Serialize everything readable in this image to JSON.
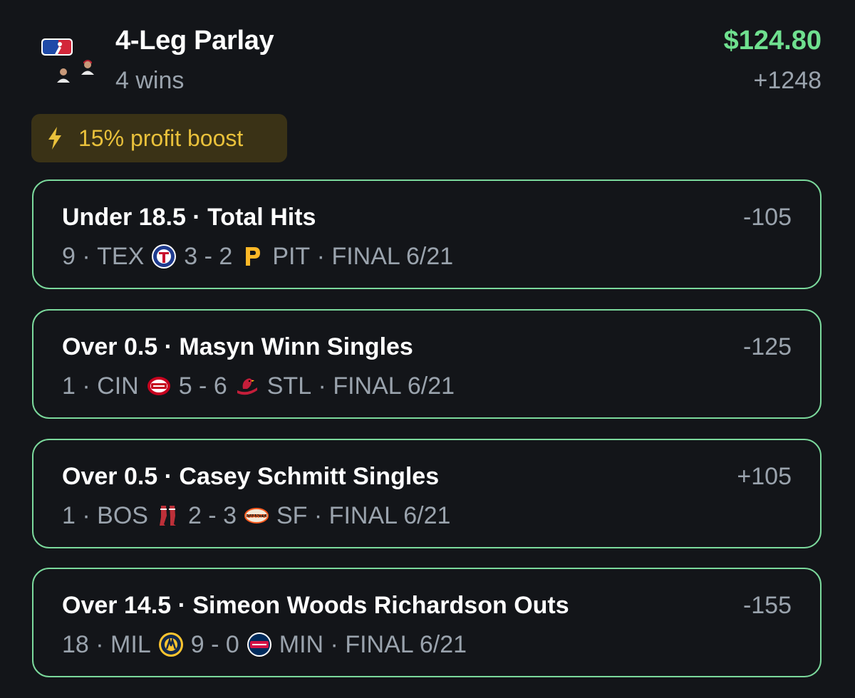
{
  "header": {
    "title": "4-Leg Parlay",
    "subtitle": "4 wins",
    "payout": "$124.80",
    "odds": "+1248",
    "icons": [
      "mlb-logo-icon",
      "player-headshot-icon",
      "player-headshot-icon"
    ]
  },
  "boost": {
    "icon": "lightning-bolt-icon",
    "label": "15% profit boost"
  },
  "legs": [
    {
      "title": "Under 18.5 · Total Hits",
      "odds": "-105",
      "result": "9",
      "away_team": "TEX",
      "away_logo": "rangers-logo-icon",
      "score": "3 - 2",
      "home_logo": "pirates-logo-icon",
      "home_team": "PIT",
      "status": "FINAL 6/21"
    },
    {
      "title": "Over 0.5 · Masyn Winn Singles",
      "odds": "-125",
      "result": "1",
      "away_team": "CIN",
      "away_logo": "reds-logo-icon",
      "score": "5 - 6",
      "home_logo": "cardinals-logo-icon",
      "home_team": "STL",
      "status": "FINAL 6/21"
    },
    {
      "title": "Over 0.5 · Casey Schmitt Singles",
      "odds": "+105",
      "result": "1",
      "away_team": "BOS",
      "away_logo": "red-sox-logo-icon",
      "score": "2 - 3",
      "home_logo": "giants-logo-icon",
      "home_team": "SF",
      "status": "FINAL 6/21"
    },
    {
      "title": "Over 14.5 · Simeon Woods Richardson Outs",
      "odds": "-155",
      "result": "18",
      "away_team": "MIL",
      "away_logo": "brewers-logo-icon",
      "score": "9 - 0",
      "home_logo": "twins-logo-icon",
      "home_team": "MIN",
      "status": "FINAL 6/21"
    }
  ],
  "colors": {
    "background": "#131519",
    "payout_green": "#6fe08f",
    "leg_border": "#7bd99c",
    "boost_bg": "#3a3216",
    "boost_text": "#e9c13b",
    "muted_text": "#9aa3ad"
  }
}
